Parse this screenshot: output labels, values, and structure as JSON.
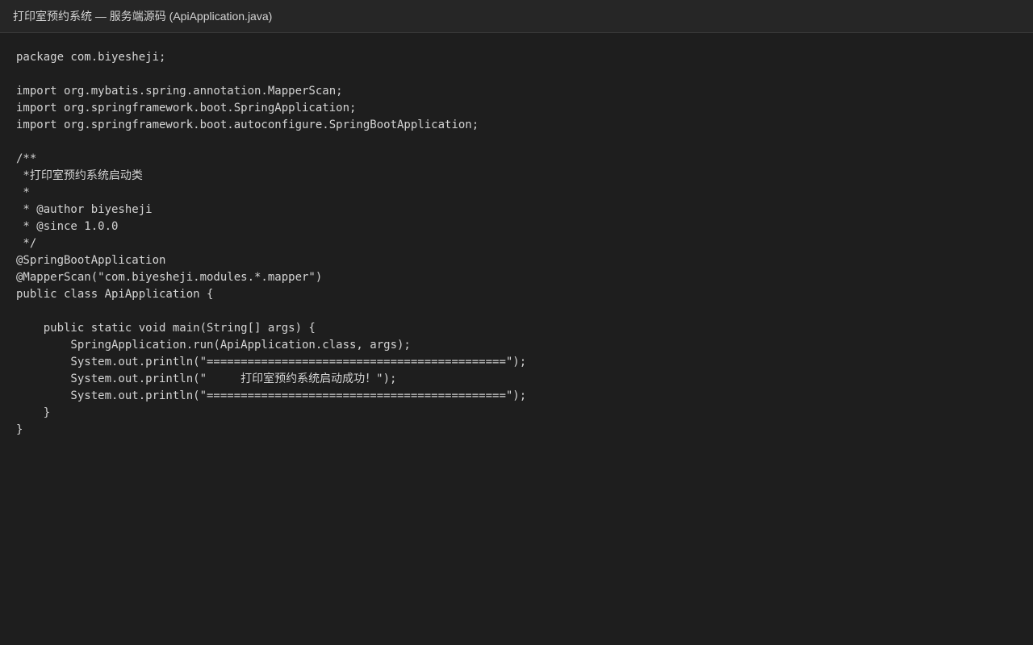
{
  "window": {
    "title": "打印室预约系统 — 服务端源码 (ApiApplication.java)"
  },
  "editor": {
    "lines": [
      "package com.biyesheji;",
      "",
      "import org.mybatis.spring.annotation.MapperScan;",
      "import org.springframework.boot.SpringApplication;",
      "import org.springframework.boot.autoconfigure.SpringBootApplication;",
      "",
      "/**",
      " *打印室预约系统启动类",
      " *",
      " * @author biyesheji",
      " * @since 1.0.0",
      " */",
      "@SpringBootApplication",
      "@MapperScan(\"com.biyesheji.modules.*.mapper\")",
      "public class ApiApplication {",
      "",
      "    public static void main(String[] args) {",
      "        SpringApplication.run(ApiApplication.class, args);",
      "        System.out.println(\"============================================\");",
      "        System.out.println(\"     打印室预约系统启动成功！\");",
      "        System.out.println(\"============================================\");",
      "    }",
      "}"
    ]
  },
  "colors": {
    "background": "#1e1e1e",
    "titlebar": "#262626",
    "text": "#d4d4d4"
  }
}
